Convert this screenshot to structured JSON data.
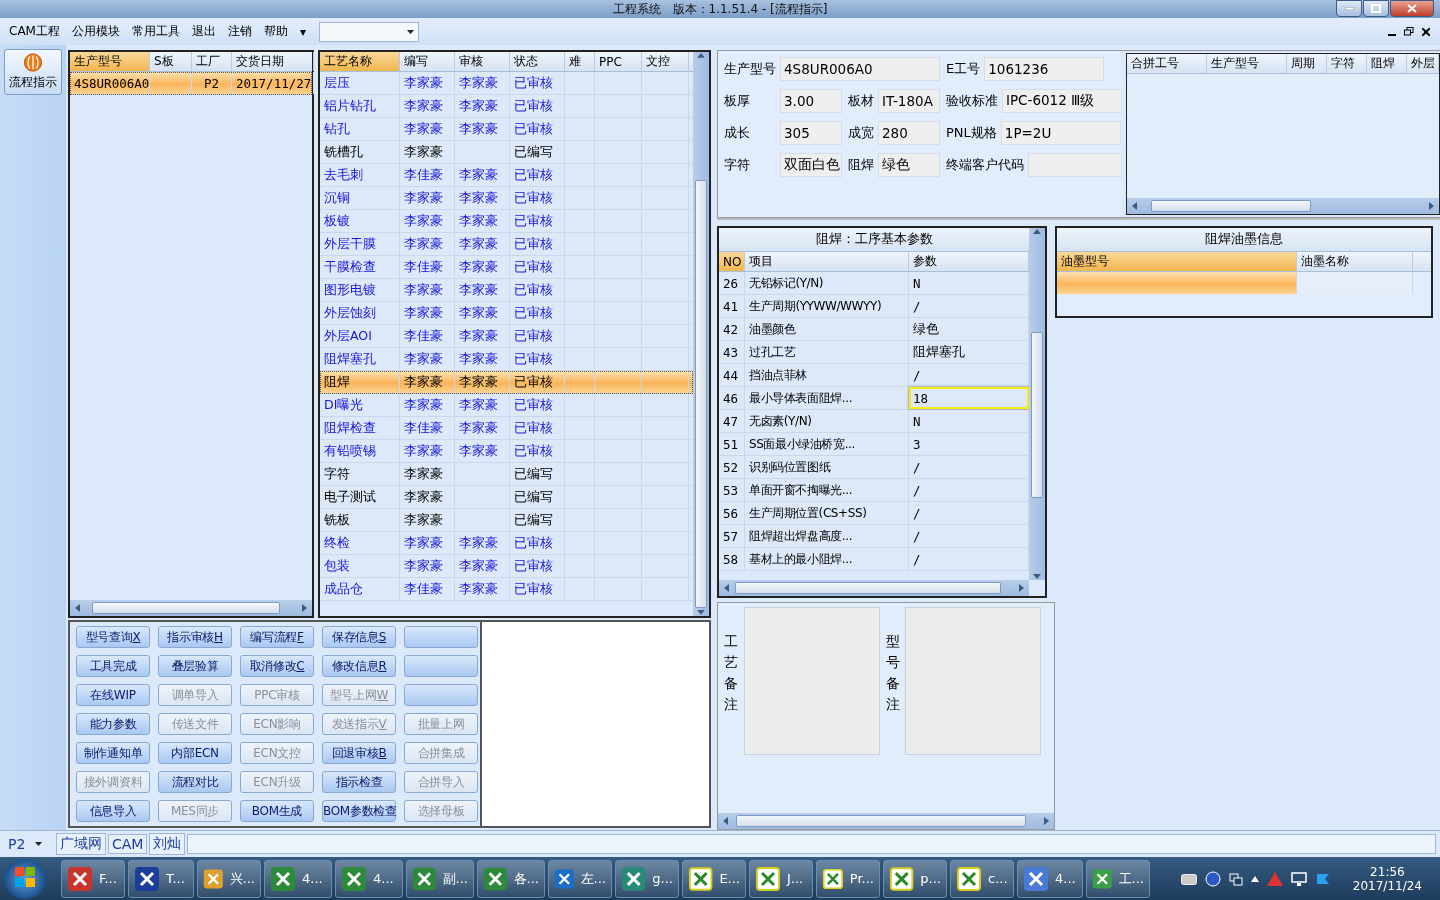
{
  "window": {
    "title": "工程系统　版本：1.1.51.4 - [流程指示]"
  },
  "menu": {
    "items": [
      "CAM工程",
      "公用模块",
      "常用工具",
      "退出",
      "注销",
      "帮助"
    ],
    "more": "▾"
  },
  "nav": {
    "label": "流程指示",
    "selected": true
  },
  "orders": {
    "columns": [
      "生产型号",
      "S板",
      "工厂",
      "交货日期"
    ],
    "rows": [
      {
        "model": "4S8UR006A0",
        "factory": "P2",
        "date": "2017/11/27",
        "selected": true
      }
    ]
  },
  "process": {
    "columns": [
      "工艺名称",
      "编写",
      "审核",
      "状态",
      "难",
      "PPC",
      "文控"
    ],
    "rows": [
      {
        "name": "层压",
        "writer": "李家豪",
        "reviewer": "李家豪",
        "status": "已审核",
        "reviewed": true,
        "selected": false
      },
      {
        "name": "铝片钻孔",
        "writer": "李家豪",
        "reviewer": "李家豪",
        "status": "已审核",
        "reviewed": true,
        "selected": false
      },
      {
        "name": "钻孔",
        "writer": "李家豪",
        "reviewer": "李家豪",
        "status": "已审核",
        "reviewed": true,
        "selected": false
      },
      {
        "name": "铣槽孔",
        "writer": "李家豪",
        "status": "已编写",
        "reviewed": false,
        "selected": false
      },
      {
        "name": "去毛刺",
        "writer": "李佳豪",
        "reviewer": "李家豪",
        "status": "已审核",
        "reviewed": true,
        "selected": false
      },
      {
        "name": "沉铜",
        "writer": "李家豪",
        "reviewer": "李家豪",
        "status": "已审核",
        "reviewed": true,
        "selected": false
      },
      {
        "name": "板镀",
        "writer": "李家豪",
        "reviewer": "李家豪",
        "status": "已审核",
        "reviewed": true,
        "selected": false
      },
      {
        "name": "外层干膜",
        "writer": "李家豪",
        "reviewer": "李家豪",
        "status": "已审核",
        "reviewed": true,
        "selected": false
      },
      {
        "name": "干膜检查",
        "writer": "李佳豪",
        "reviewer": "李家豪",
        "status": "已审核",
        "reviewed": true,
        "selected": false
      },
      {
        "name": "图形电镀",
        "writer": "李家豪",
        "reviewer": "李家豪",
        "status": "已审核",
        "reviewed": true,
        "selected": false
      },
      {
        "name": "外层蚀刻",
        "writer": "李家豪",
        "reviewer": "李家豪",
        "status": "已审核",
        "reviewed": true,
        "selected": false
      },
      {
        "name": "外层AOI",
        "writer": "李佳豪",
        "reviewer": "李家豪",
        "status": "已审核",
        "reviewed": true,
        "selected": false
      },
      {
        "name": "阻焊塞孔",
        "writer": "李家豪",
        "reviewer": "李家豪",
        "status": "已审核",
        "reviewed": true,
        "selected": false
      },
      {
        "name": "阻焊",
        "writer": "李家豪",
        "reviewer": "李家豪",
        "status": "已审核",
        "reviewed": true,
        "selected": true
      },
      {
        "name": "DI曝光",
        "writer": "李家豪",
        "reviewer": "李家豪",
        "status": "已审核",
        "reviewed": true,
        "selected": false
      },
      {
        "name": "阻焊检查",
        "writer": "李佳豪",
        "reviewer": "李家豪",
        "status": "已审核",
        "reviewed": true,
        "selected": false
      },
      {
        "name": "有铅喷锡",
        "writer": "李家豪",
        "reviewer": "李家豪",
        "status": "已审核",
        "reviewed": true,
        "selected": false
      },
      {
        "name": "字符",
        "writer": "李家豪",
        "status": "已编写",
        "reviewed": false,
        "selected": false
      },
      {
        "name": "电子测试",
        "writer": "李家豪",
        "status": "已编写",
        "reviewed": false,
        "selected": false
      },
      {
        "name": "铣板",
        "writer": "李家豪",
        "status": "已编写",
        "reviewed": false,
        "selected": false
      },
      {
        "name": "终检",
        "writer": "李家豪",
        "reviewer": "李家豪",
        "status": "已审核",
        "reviewed": true,
        "selected": false
      },
      {
        "name": "包装",
        "writer": "李家豪",
        "reviewer": "李家豪",
        "status": "已审核",
        "reviewed": true,
        "selected": false
      },
      {
        "name": "成品仓",
        "writer": "李佳豪",
        "reviewer": "李家豪",
        "status": "已审核",
        "reviewed": true,
        "selected": false
      }
    ]
  },
  "buttons": [
    {
      "label": "型号查询",
      "key": "X",
      "disabled": false
    },
    {
      "label": "指示审核",
      "key": "H",
      "disabled": false
    },
    {
      "label": "编写流程",
      "key": "F",
      "disabled": false
    },
    {
      "label": "保存信息",
      "key": "S",
      "disabled": false
    },
    {
      "disabled": false
    },
    {
      "label": "工具完成",
      "disabled": false
    },
    {
      "label": "叠层验算",
      "disabled": false
    },
    {
      "label": "取消修改",
      "key": "C",
      "disabled": false
    },
    {
      "label": "修改信息",
      "key": "R",
      "disabled": false
    },
    {
      "disabled": false
    },
    {
      "label": "在线WIP",
      "disabled": false
    },
    {
      "label": "调单导入",
      "disabled": true
    },
    {
      "label": "PPC审核",
      "disabled": true
    },
    {
      "label": "型号上网",
      "key": "W",
      "disabled": true
    },
    {
      "disabled": false
    },
    {
      "label": "能力参数",
      "disabled": false
    },
    {
      "label": "传送文件",
      "disabled": true
    },
    {
      "label": "ECN影响",
      "disabled": true
    },
    {
      "label": "发送指示",
      "key": "V",
      "disabled": true
    },
    {
      "label": "批量上网",
      "disabled": true
    },
    {
      "label": "制作通知单",
      "disabled": false
    },
    {
      "label": "内部ECN",
      "disabled": false
    },
    {
      "label": "ECN文控",
      "disabled": true
    },
    {
      "label": "回退审核",
      "key": "B",
      "disabled": false
    },
    {
      "label": "合拼集成",
      "disabled": true
    },
    {
      "label": "接外调资料",
      "disabled": true
    },
    {
      "label": "流程对比",
      "disabled": false
    },
    {
      "label": "ECN升级",
      "disabled": true
    },
    {
      "label": "指示检查",
      "disabled": false
    },
    {
      "label": "合拼导入",
      "disabled": true
    },
    {
      "label": "信息导入",
      "disabled": false
    },
    {
      "label": "MES同步",
      "disabled": true
    },
    {
      "label": "BOM生成",
      "disabled": false
    },
    {
      "label": "BOM参数检查",
      "disabled": false
    },
    {
      "label": "选择母板",
      "disabled": true
    }
  ],
  "info": {
    "model": {
      "label": "生产型号",
      "value": "4S8UR006A0"
    },
    "job_no": {
      "label": "E工号",
      "value": "1061236"
    },
    "rows": [
      [
        {
          "label": "板厚",
          "value": "3.00"
        },
        {
          "label": "板材",
          "value": "IT-180A"
        },
        {
          "label": "验收标准",
          "value": "IPC-6012 Ⅲ级"
        }
      ],
      [
        {
          "label": "成长",
          "value": "305"
        },
        {
          "label": "成宽",
          "value": "280"
        },
        {
          "label": "PNL规格",
          "value": "1P=2U"
        }
      ],
      [
        {
          "label": "字符",
          "value": "双面白色"
        },
        {
          "label": "阻焊",
          "value": "绿色"
        },
        {
          "label": "终端客户代码"
        }
      ]
    ]
  },
  "merge_table": {
    "columns": [
      "合拼工号",
      "生产型号",
      "周期",
      "字符",
      "阻焊",
      "外层"
    ]
  },
  "params": {
    "title": "阻焊：工序基本参数",
    "columns": [
      "NO",
      "项目",
      "参数"
    ],
    "rows": [
      {
        "no": "26",
        "item": "无铅标记(Y/N)",
        "value": "N",
        "focused": false
      },
      {
        "no": "41",
        "item": "生产周期(YYWW/WWYY)",
        "value": "/",
        "focused": false
      },
      {
        "no": "42",
        "item": "油墨颜色",
        "value": "绿色",
        "focused": false
      },
      {
        "no": "43",
        "item": "过孔工艺",
        "value": "阻焊塞孔",
        "focused": false
      },
      {
        "no": "44",
        "item": "挡油点菲林",
        "value": "/",
        "focused": false
      },
      {
        "no": "46",
        "item": "最小导体表面阻焊...",
        "value": "18",
        "focused": true
      },
      {
        "no": "47",
        "item": "无卤素(Y/N)",
        "value": "N",
        "focused": false
      },
      {
        "no": "51",
        "item": "SS面最小绿油桥宽...",
        "value": "3",
        "focused": false
      },
      {
        "no": "52",
        "item": "识别码位置图纸",
        "value": "/",
        "focused": false
      },
      {
        "no": "53",
        "item": "单面开窗不掏曝光...",
        "value": "/",
        "focused": false
      },
      {
        "no": "56",
        "item": "生产周期位置(CS+SS)",
        "value": "/",
        "focused": false
      },
      {
        "no": "57",
        "item": "阻焊超出焊盘高度...",
        "value": "/",
        "focused": false
      },
      {
        "no": "58",
        "item": "基材上的最小阻焊...",
        "value": "/",
        "focused": false
      }
    ]
  },
  "ink": {
    "title": "阻焊油墨信息",
    "columns": [
      "油墨型号",
      "油墨名称"
    ]
  },
  "remarks": [
    {
      "label": "工艺备注"
    },
    {
      "label": "型号备注"
    }
  ],
  "status_bar": {
    "factory": "P2",
    "items": [
      "广域网",
      "CAM",
      "刘灿"
    ]
  },
  "taskbar": {
    "items": [
      "F...",
      "T...",
      "兴...",
      "4...",
      "4...",
      "副...",
      "各...",
      "左...",
      "g...",
      "E...",
      "J...",
      "Pr...",
      "p...",
      "c...",
      "4...",
      "工..."
    ],
    "time": "21:56",
    "date": "2017/11/24"
  }
}
